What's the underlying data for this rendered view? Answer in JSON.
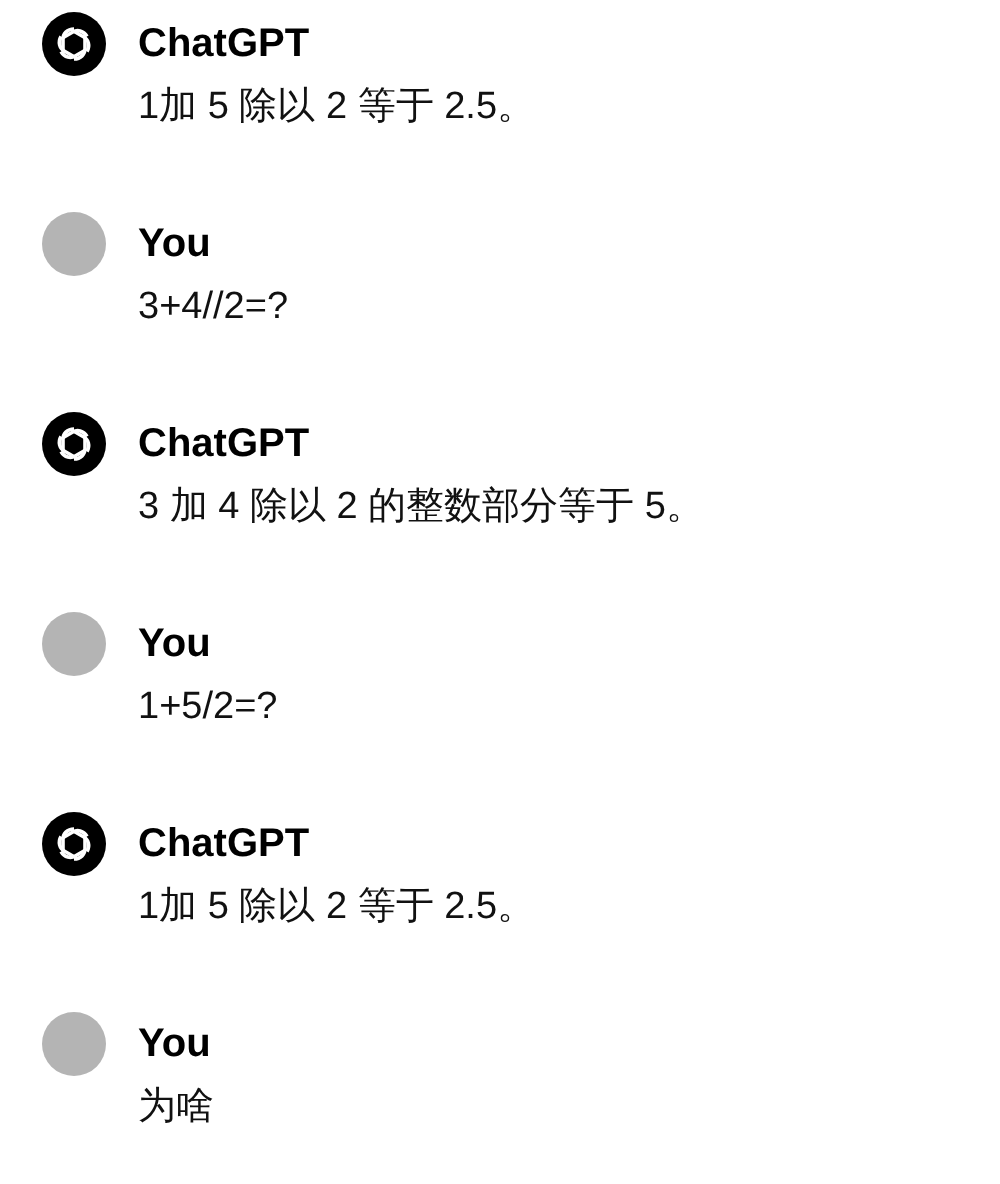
{
  "messages": [
    {
      "author": "ChatGPT",
      "kind": "assistant",
      "text": "1加 5 除以 2 等于 2.5。"
    },
    {
      "author": "You",
      "kind": "user",
      "text": "3+4//2=?"
    },
    {
      "author": "ChatGPT",
      "kind": "assistant",
      "text": "3 加 4 除以 2 的整数部分等于 5。"
    },
    {
      "author": "You",
      "kind": "user",
      "text": "1+5/2=?"
    },
    {
      "author": "ChatGPT",
      "kind": "assistant",
      "text": "1加 5 除以 2 等于 2.5。"
    },
    {
      "author": "You",
      "kind": "user",
      "text": "为啥"
    }
  ]
}
